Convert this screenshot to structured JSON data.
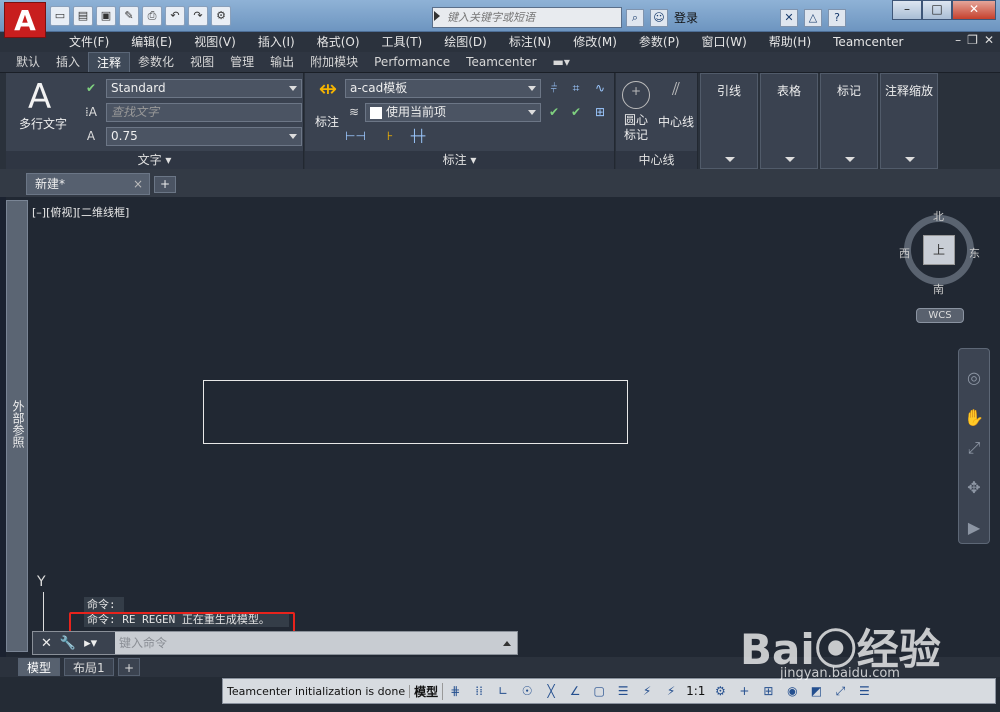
{
  "app": {
    "logo_letter": "A",
    "search_placeholder": "键入关键字或短语",
    "login_label": "登录",
    "help_icon": "?",
    "window": {
      "minimize": "–",
      "restore": "□",
      "close": "✕"
    }
  },
  "menu": {
    "items": [
      "文件(F)",
      "编辑(E)",
      "视图(V)",
      "插入(I)",
      "格式(O)",
      "工具(T)",
      "绘图(D)",
      "标注(N)",
      "修改(M)",
      "参数(P)",
      "窗口(W)",
      "帮助(H)",
      "Teamcenter"
    ]
  },
  "ribbon_tabs": {
    "items": [
      "默认",
      "插入",
      "注释",
      "参数化",
      "视图",
      "管理",
      "输出",
      "附加模块",
      "Performance",
      "Teamcenter"
    ],
    "active": "注释"
  },
  "ribbon": {
    "text_panel": {
      "big_glyph": "A",
      "big_button": "多行文字",
      "style_value": "Standard",
      "find_placeholder": "查找文字",
      "height_value": "0.75",
      "title": "文字"
    },
    "dim_panel": {
      "button": "标注",
      "style_value": "a-cad模板",
      "layer_value": "使用当前项",
      "title": "标注"
    },
    "centerline_panel": {
      "center_mark": "圆心\n标记",
      "centerline": "中心线",
      "title": "中心线"
    },
    "right_panels": [
      "引线",
      "表格",
      "标记",
      "注释缩放"
    ]
  },
  "doc_tabs": {
    "active": "新建*",
    "close": "×",
    "add": "+"
  },
  "viewport": {
    "label": "[–][俯视][二维线框]",
    "xref": "外部参照"
  },
  "viewcube": {
    "north": "北",
    "south": "南",
    "east": "东",
    "west": "西",
    "top": "上",
    "wcs": "WCS"
  },
  "ucs": {
    "y": "Y"
  },
  "command": {
    "history": [
      "命令:",
      "命令: RE REGEN 正在重生成模型。"
    ],
    "input_placeholder": "键入命令"
  },
  "layout_tabs": {
    "items": [
      "模型",
      "布局1"
    ],
    "active": "模型",
    "add": "+"
  },
  "status": {
    "message": "Teamcenter initialization is done",
    "model": "模型",
    "scale": "1:1"
  },
  "watermark": {
    "main": "Bai⦿经验",
    "url": "jingyan.baidu.com"
  },
  "colors": {
    "accent_red": "#e8231c",
    "canvas": "#212833",
    "logo": "#c81e1e"
  }
}
